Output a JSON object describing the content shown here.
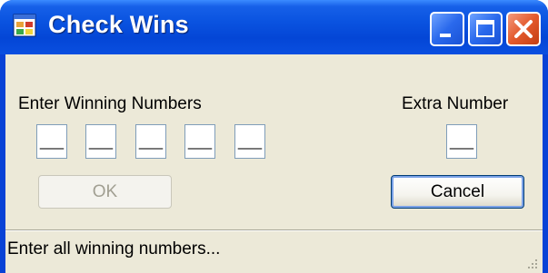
{
  "window": {
    "title": "Check Wins",
    "title_icon": "app-window-icon",
    "controls": [
      "minimize-icon",
      "maximize-icon",
      "close-icon"
    ]
  },
  "form": {
    "winning_label": "Enter Winning Numbers",
    "extra_label": "Extra Number",
    "winning_placeholders": [
      "__",
      "__",
      "__",
      "__",
      "__"
    ],
    "extra_placeholder": "__",
    "ok_label": "OK",
    "ok_enabled": false,
    "cancel_label": "Cancel"
  },
  "status": {
    "text": "Enter all winning numbers..."
  },
  "colors": {
    "titlebar": "#0a53e0",
    "client_bg": "#ece9d8",
    "close_button": "#e35a2d",
    "input_border": "#7f9db9"
  }
}
